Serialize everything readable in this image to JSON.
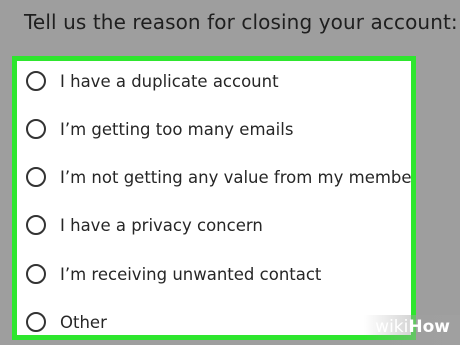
{
  "prompt": "Tell us the reason for closing your account:",
  "options": [
    {
      "label": "I have a duplicate account",
      "selected": false
    },
    {
      "label": "I’m getting too many emails",
      "selected": false
    },
    {
      "label": "I’m not getting any value from my membership",
      "selected": false
    },
    {
      "label": "I have a privacy concern",
      "selected": false
    },
    {
      "label": "I’m receiving unwanted contact",
      "selected": false
    },
    {
      "label": "Other",
      "selected": false
    }
  ],
  "highlight_color": "#2ee62e",
  "watermark": {
    "part1": "wiki",
    "part2": "How"
  }
}
